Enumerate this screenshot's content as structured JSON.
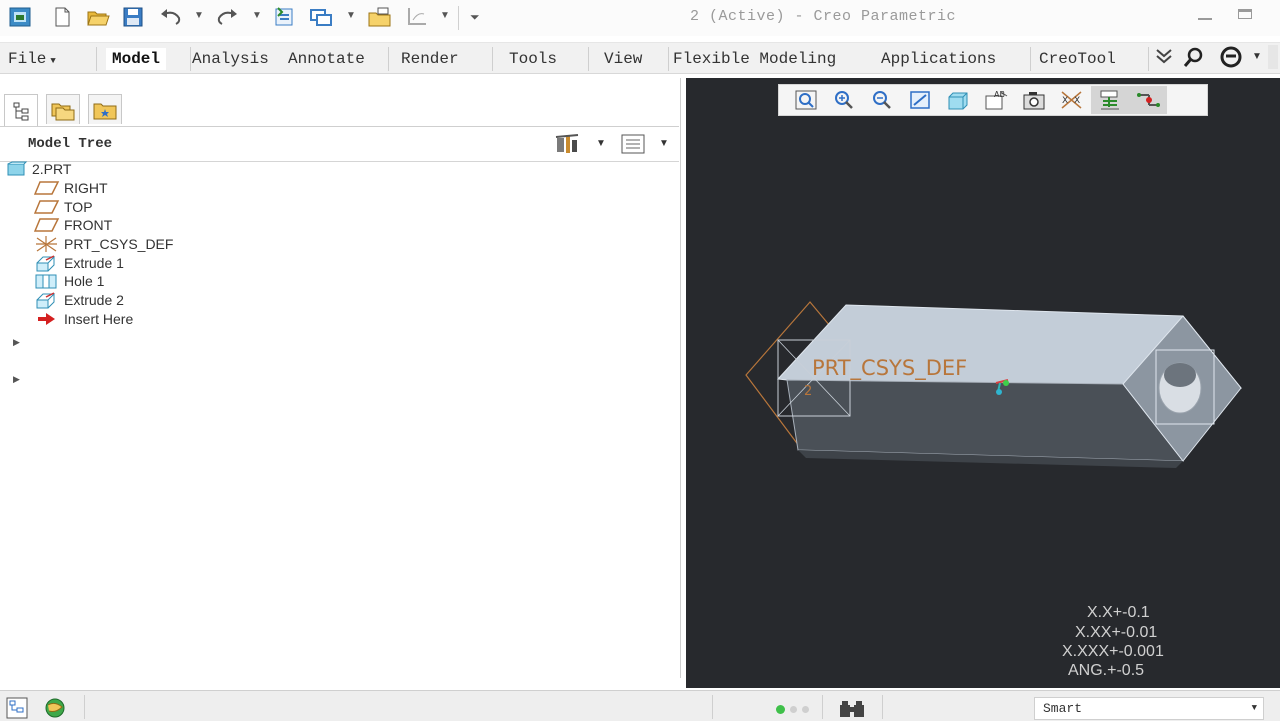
{
  "window": {
    "title": "2 (Active) - Creo Parametric"
  },
  "ribbon": {
    "tabs": [
      {
        "label": "File"
      },
      {
        "label": "Model"
      },
      {
        "label": "Analysis"
      },
      {
        "label": "Annotate"
      },
      {
        "label": "Render"
      },
      {
        "label": "Tools"
      },
      {
        "label": "View"
      },
      {
        "label": "Flexible Modeling"
      },
      {
        "label": "Applications"
      },
      {
        "label": "CreoTool"
      }
    ]
  },
  "model_tree": {
    "title": "Model Tree",
    "items": [
      {
        "label": "2.PRT",
        "icon": "part-icon"
      },
      {
        "label": "RIGHT",
        "icon": "datum-plane-icon"
      },
      {
        "label": "TOP",
        "icon": "datum-plane-icon"
      },
      {
        "label": "FRONT",
        "icon": "datum-plane-icon"
      },
      {
        "label": "PRT_CSYS_DEF",
        "icon": "csys-icon"
      },
      {
        "label": "Extrude 1",
        "icon": "extrude-icon"
      },
      {
        "label": "Hole 1",
        "icon": "hole-icon"
      },
      {
        "label": "Extrude 2",
        "icon": "extrude-icon"
      },
      {
        "label": "Insert Here",
        "icon": "insert-arrow-icon"
      }
    ]
  },
  "viewport": {
    "csys_label": "PRT_CSYS_DEF",
    "tolerances": [
      "X.X+-0.1",
      "X.XX+-0.01",
      "X.XXX+-0.001",
      "ANG.+-0.5"
    ]
  },
  "statusbar": {
    "filter_value": "Smart"
  },
  "colors": {
    "viewport_bg": "#27292d",
    "datum_color": "#b8763b",
    "accent": "#2f8fd0"
  }
}
